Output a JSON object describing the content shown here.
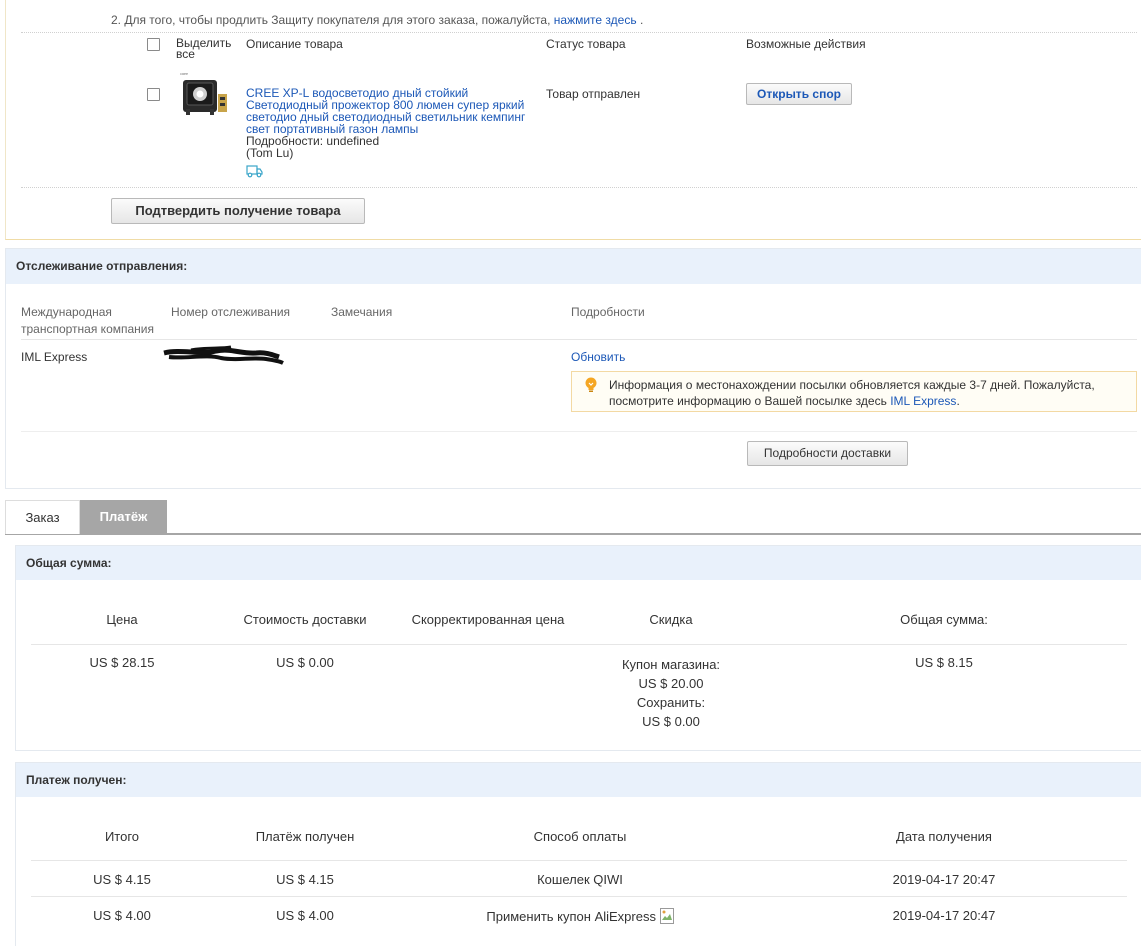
{
  "order": {
    "notice_text": "2. Для того, чтобы продлить Защиту покупателя для этого заказа, пожалуйста,",
    "notice_link": "нажмите здесь",
    "notice_tail": ".",
    "columns": {
      "select_all": "Выделить все",
      "description": "Описание товара",
      "status": "Статус товара",
      "actions": "Возможные действия"
    },
    "product": {
      "title": "CREE XP-L водосветодио дный стойкий Светодиодный прожектор 800 люмен супер яркий светодио дный светодиодный светильник кемпинг свет портативный газон лампы",
      "details": "Подробности: undefined",
      "seller": "(Tom Lu)",
      "status": "Товар отправлен",
      "dispute_button": "Открыть спор"
    },
    "confirm_button": "Подтвердить получение товара"
  },
  "tracking": {
    "header": "Отслеживание отправления:",
    "columns": {
      "company": "Международная транспортная компания",
      "number": "Номер отслеживания",
      "remarks": "Замечания",
      "details": "Подробности"
    },
    "row": {
      "company": "IML Express",
      "refresh_link": "Обновить",
      "info_text": "Информация о местонахождении посылки обновляется каждые 3-7 дней. Пожалуйста, посмотрите информацию о Вашей посылке здесь",
      "info_link": "IML Express",
      "info_tail": "."
    },
    "delivery_details_button": "Подробности доставки"
  },
  "tabs": [
    {
      "label": "Заказ",
      "active": false
    },
    {
      "label": "Платёж",
      "active": true
    }
  ],
  "total": {
    "header": "Общая сумма:",
    "columns": [
      "Цена",
      "Стоимость доставки",
      "Скорректированная цена",
      "Скидка",
      "Общая сумма:"
    ],
    "price": "US $ 28.15",
    "shipping": "US $ 0.00",
    "adjusted": "",
    "discount": {
      "coupon_label": "Купон магазина:",
      "coupon_value": "US $ 20.00",
      "save_label": "Сохранить:",
      "save_value": "US $ 0.00"
    },
    "total": "US $ 8.15"
  },
  "payment": {
    "header": "Платеж получен:",
    "columns": [
      "Итого",
      "Платёж получен",
      "Способ оплаты",
      "Дата получения"
    ],
    "rows": [
      {
        "total": "US $ 4.15",
        "received": "US $ 4.15",
        "method": "Кошелек QIWI",
        "date": "2019-04-17 20:47"
      },
      {
        "total": "US $ 4.00",
        "received": "US $ 4.00",
        "method": "Применить купон AliExpress",
        "date": "2019-04-17 20:47"
      }
    ]
  },
  "colors": {
    "link": "#1c58b7",
    "section_header_bg": "#e9f1fb",
    "active_tab_bg": "#a6a6a6",
    "info_icon": "#f5a623"
  }
}
